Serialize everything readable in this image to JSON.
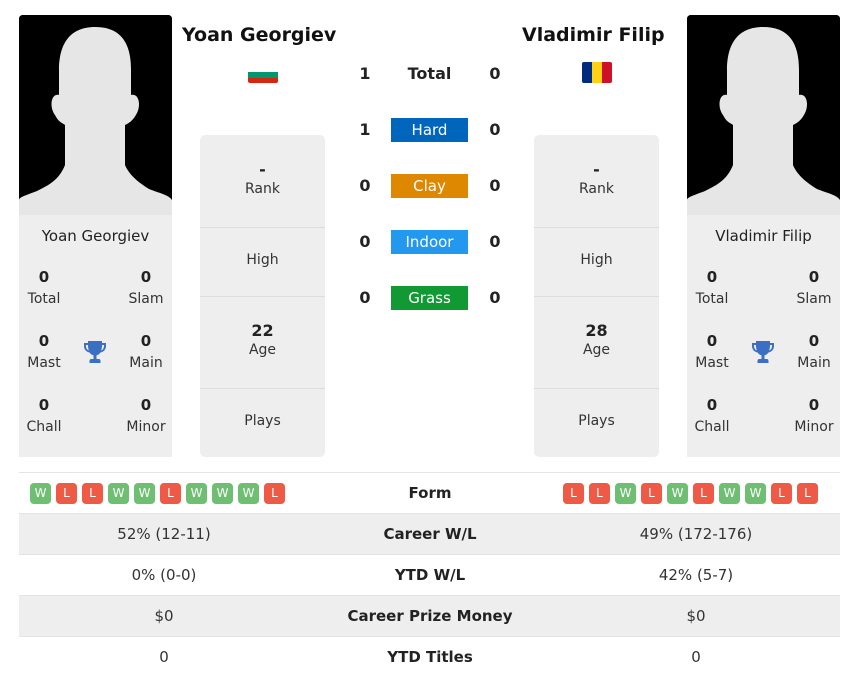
{
  "player_left": {
    "name": "Yoan Georgiev",
    "flag": "bulgaria-flag",
    "flag_colors": [
      "#ffffff",
      "#00966e",
      "#d62612"
    ],
    "titles": {
      "total": {
        "value": "0",
        "label": "Total"
      },
      "slam": {
        "value": "0",
        "label": "Slam"
      },
      "mast": {
        "value": "0",
        "label": "Mast"
      },
      "main": {
        "value": "0",
        "label": "Main"
      },
      "chall": {
        "value": "0",
        "label": "Chall"
      },
      "minor": {
        "value": "0",
        "label": "Minor"
      }
    },
    "stats": {
      "rank": {
        "value": "-",
        "label": "Rank"
      },
      "high": {
        "value": "",
        "label": "High"
      },
      "age": {
        "value": "22",
        "label": "Age"
      },
      "plays": {
        "value": "",
        "label": "Plays"
      }
    },
    "form": [
      "W",
      "L",
      "L",
      "W",
      "W",
      "L",
      "W",
      "W",
      "W",
      "L"
    ]
  },
  "player_right": {
    "name": "Vladimir Filip",
    "flag": "romania-flag",
    "flag_colors": [
      "#002b7f",
      "#fcd116",
      "#ce1126"
    ],
    "titles": {
      "total": {
        "value": "0",
        "label": "Total"
      },
      "slam": {
        "value": "0",
        "label": "Slam"
      },
      "mast": {
        "value": "0",
        "label": "Mast"
      },
      "main": {
        "value": "0",
        "label": "Main"
      },
      "chall": {
        "value": "0",
        "label": "Chall"
      },
      "minor": {
        "value": "0",
        "label": "Minor"
      }
    },
    "stats": {
      "rank": {
        "value": "-",
        "label": "Rank"
      },
      "high": {
        "value": "",
        "label": "High"
      },
      "age": {
        "value": "28",
        "label": "Age"
      },
      "plays": {
        "value": "",
        "label": "Plays"
      }
    },
    "form": [
      "L",
      "L",
      "W",
      "L",
      "W",
      "L",
      "W",
      "W",
      "L",
      "L"
    ]
  },
  "h2h": [
    {
      "label": "Total",
      "left": "1",
      "right": "0",
      "color": null
    },
    {
      "label": "Hard",
      "left": "1",
      "right": "0",
      "color": "#0066bb"
    },
    {
      "label": "Clay",
      "left": "0",
      "right": "0",
      "color": "#dd8800"
    },
    {
      "label": "Indoor",
      "left": "0",
      "right": "0",
      "color": "#2299ee"
    },
    {
      "label": "Grass",
      "left": "0",
      "right": "0",
      "color": "#119933"
    }
  ],
  "comparison": {
    "form_label": "Form",
    "rows": [
      {
        "label": "Career W/L",
        "left": "52% (12-11)",
        "right": "49% (172-176)"
      },
      {
        "label": "YTD W/L",
        "left": "0% (0-0)",
        "right": "42% (5-7)"
      },
      {
        "label": "Career Prize Money",
        "left": "$0",
        "right": "$0"
      },
      {
        "label": "YTD Titles",
        "left": "0",
        "right": "0"
      }
    ]
  },
  "colors": {
    "win": "#6fbf73",
    "loss": "#ee5a45",
    "trophy": "#3a6fc4"
  }
}
